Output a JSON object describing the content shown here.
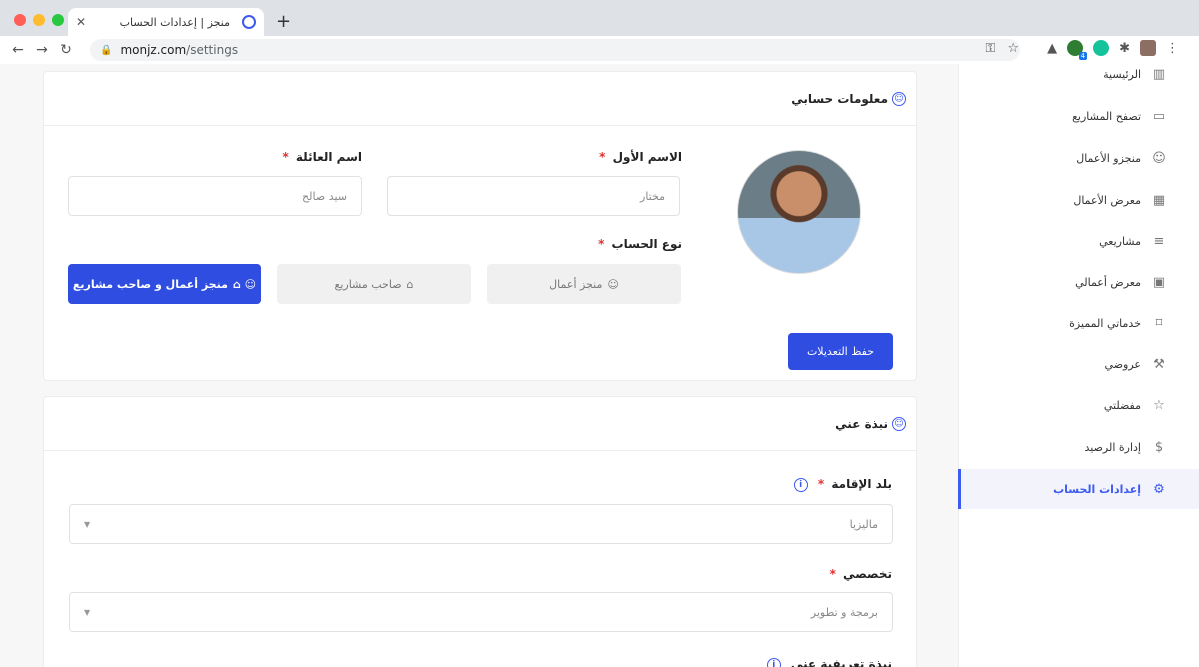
{
  "browser": {
    "tab_title": "منجز | إعدادات الحساب",
    "tab_close": "✕",
    "new_tab": "+",
    "url_host": "monjz.com",
    "url_path": "/settings",
    "ext_badge": "4"
  },
  "sidebar": {
    "items": [
      {
        "label": "الرئيسية",
        "icon": "bar-chart-icon",
        "glyph": "▥"
      },
      {
        "label": "تصفح المشاريع",
        "icon": "briefcase-icon",
        "glyph": "▭"
      },
      {
        "label": "منجزو الأعمال",
        "icon": "users-icon",
        "glyph": "☺"
      },
      {
        "label": "معرض الأعمال",
        "icon": "grid-icon",
        "glyph": "▦"
      },
      {
        "label": "مشاريعي",
        "icon": "server-icon",
        "glyph": "≡"
      },
      {
        "label": "معرض أعمالي",
        "icon": "code-window-icon",
        "glyph": "▣"
      },
      {
        "label": "خدماتي المميزة",
        "icon": "bookmark-icon",
        "glyph": "⌑"
      },
      {
        "label": "عروضي",
        "icon": "gavel-icon",
        "glyph": "⚒"
      },
      {
        "label": "مفضلتي",
        "icon": "star-icon",
        "glyph": "☆"
      },
      {
        "label": "إدارة الرصيد",
        "icon": "dollar-icon",
        "glyph": "$"
      },
      {
        "label": "إعدادات الحساب",
        "icon": "gear-icon",
        "glyph": "⚙"
      }
    ]
  },
  "account_card": {
    "title": "معلومات حسابي",
    "first_name_label": "الاسم الأول",
    "first_name_value": "مختار",
    "last_name_label": "اسم العائلة",
    "last_name_value": "سيد صالح",
    "required_mark": "*",
    "account_type_label": "نوع الحساب",
    "types": [
      {
        "label": "منجز أعمال",
        "glyph": "☺",
        "active": false
      },
      {
        "label": "صاحب مشاريع",
        "glyph": "⌂",
        "active": false
      },
      {
        "label": "منجز أعمال و صاحب مشاريع",
        "glyph": "☺ ⌂",
        "active": true
      }
    ],
    "save_label": "حفظ التعديلات"
  },
  "about_card": {
    "title": "نبذة عني",
    "country_label": "بلد الإقامة",
    "country_value": "ماليزيا",
    "specialty_label": "تخصصي",
    "specialty_value": "برمجة و تطوير",
    "next_label": "نبذة تعريفية عني"
  },
  "colors": {
    "accent": "#2f4de0",
    "required": "#e03131"
  }
}
